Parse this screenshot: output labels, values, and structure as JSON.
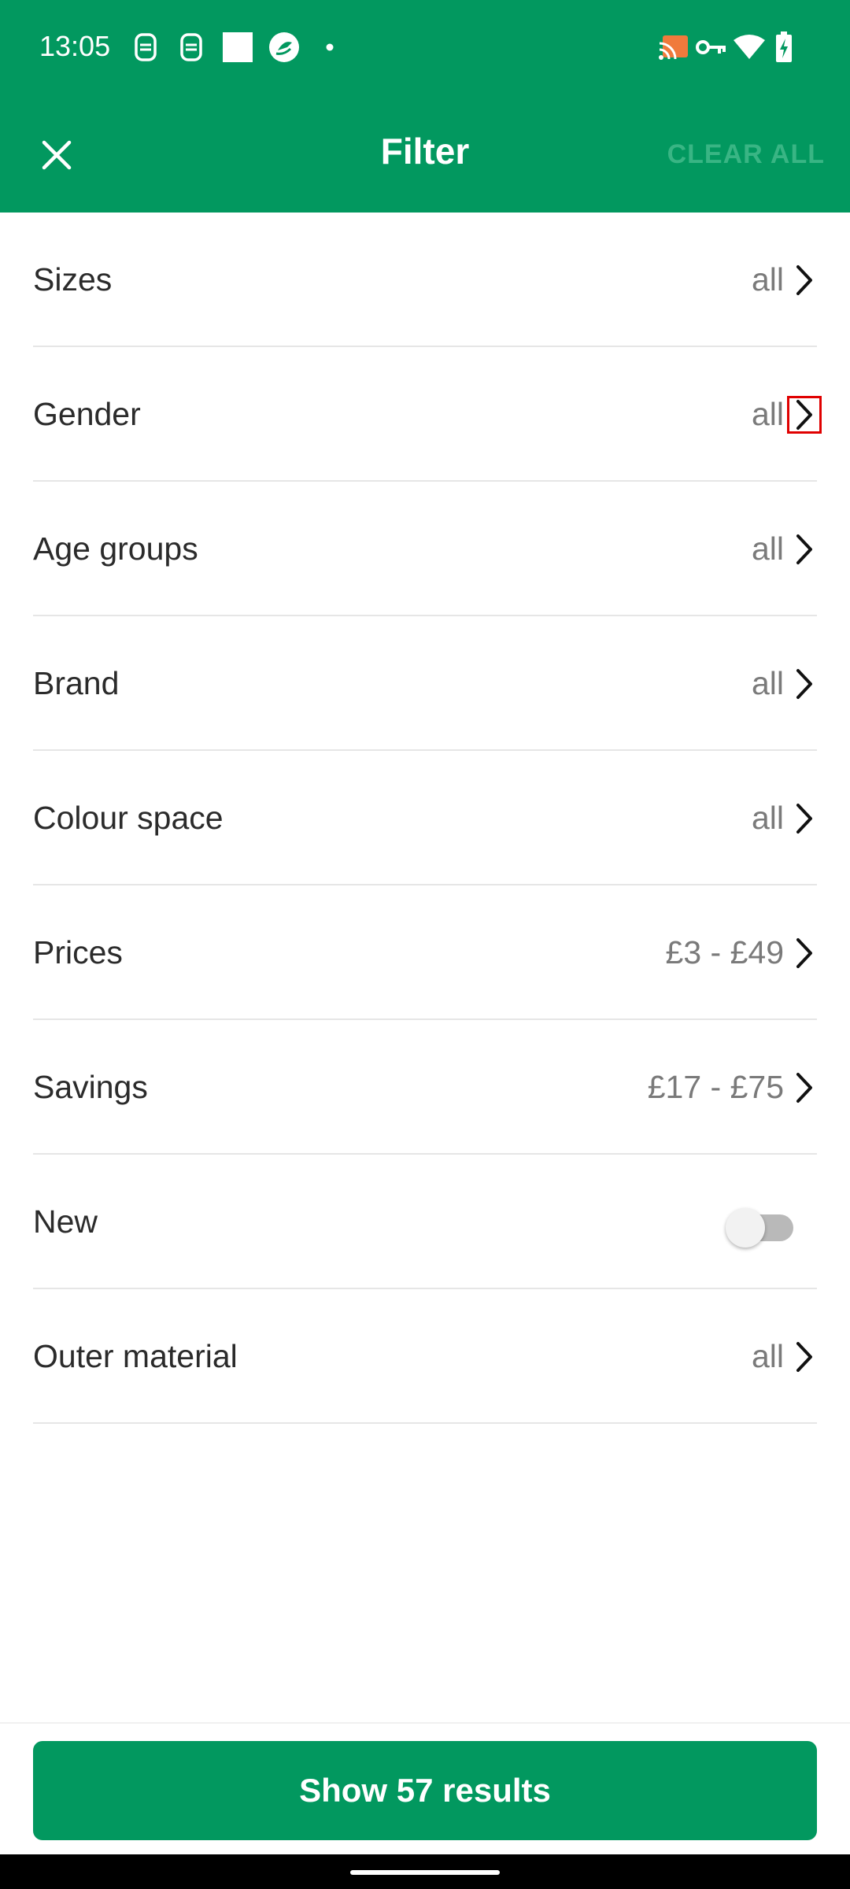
{
  "status_bar": {
    "time": "13:05",
    "left_icons": [
      "sim-card-icon",
      "sim-card-icon",
      "square-icon",
      "app-circle-icon",
      "dot-icon"
    ],
    "right_icons": [
      "cast-icon",
      "vpn-key-icon",
      "wifi-icon",
      "battery-charging-icon"
    ]
  },
  "app_bar": {
    "title": "Filter",
    "clear_all_label": "CLEAR ALL",
    "close_icon": "close-icon"
  },
  "filters": [
    {
      "label": "Sizes",
      "value": "all",
      "type": "link"
    },
    {
      "label": "Gender",
      "value": "all",
      "type": "link",
      "highlighted": true
    },
    {
      "label": "Age groups",
      "value": "all",
      "type": "link"
    },
    {
      "label": "Brand",
      "value": "all",
      "type": "link"
    },
    {
      "label": "Colour space",
      "value": "all",
      "type": "link"
    },
    {
      "label": "Prices",
      "value": "£3 - £49",
      "type": "link"
    },
    {
      "label": "Savings",
      "value": "£17 - £75",
      "type": "link"
    },
    {
      "label": "New",
      "type": "toggle",
      "toggle_on": false
    },
    {
      "label": "Outer material",
      "value": "all",
      "type": "link"
    }
  ],
  "results_button_label": "Show 57 results",
  "colors": {
    "brand_green": "#02985f",
    "clear_all_disabled": "#39b584",
    "highlight_outline": "#e00000"
  }
}
